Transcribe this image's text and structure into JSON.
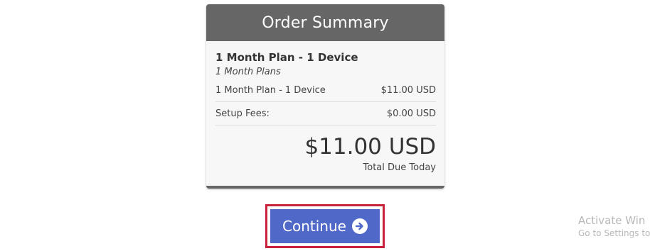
{
  "order_summary": {
    "title": "Order Summary",
    "product_name": "1 Month Plan - 1 Device",
    "product_group": "1 Month Plans",
    "lines": [
      {
        "label": "1 Month Plan - 1 Device",
        "amount": "$11.00 USD"
      },
      {
        "label": "Setup Fees:",
        "amount": "$0.00 USD"
      }
    ],
    "total_amount": "$11.00 USD",
    "total_label": "Total Due Today"
  },
  "continue_button": {
    "label": "Continue",
    "icon": "arrow-circle-right-icon"
  },
  "watermark": {
    "line1": "Activate Win",
    "line2": "Go to Settings to"
  },
  "colors": {
    "header_bg": "#666666",
    "button_bg": "#5068c8",
    "highlight_border": "#c6233a"
  }
}
